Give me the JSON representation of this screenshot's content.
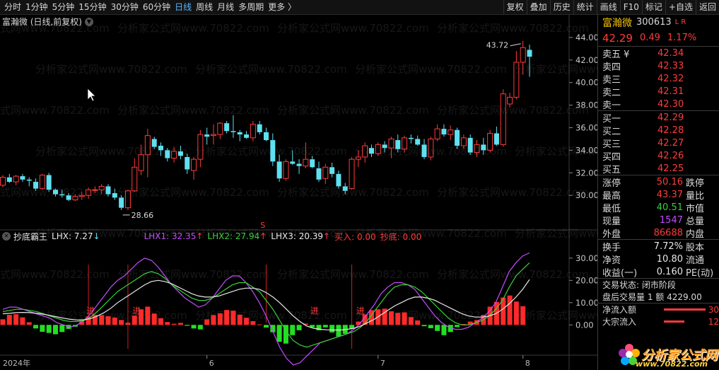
{
  "toolbar": {
    "periods": [
      "分时",
      "1分钟",
      "5分钟",
      "15分钟",
      "30分钟",
      "60分钟",
      "日线",
      "周线",
      "月线",
      "多周期",
      "更多 〉"
    ],
    "active_period": "日线",
    "buttons": [
      "复权",
      "叠加",
      "历史",
      "统计",
      "画线",
      "F10",
      "标记",
      "+自选",
      "返回"
    ]
  },
  "chart": {
    "title": "富瀚微 (日线,前复权)",
    "title_icon": "chevron-down-icon",
    "price_axis": [
      "44.00",
      "42.00",
      "40.00",
      "38.00",
      "36.00",
      "34.00",
      "32.00",
      "30.00"
    ],
    "high_label": "43.72",
    "low_label": "28.66",
    "marker_s": "S",
    "indicator": {
      "name": "抄底霸王",
      "lhx": "LHX: 7.27",
      "lhx1": "LHX1: 32.35",
      "lhx2": "LHX2: 27.94",
      "lhx3": "LHX3: 20.39",
      "buy": "买入: 0.00",
      "bottom": "抄底: 0.00",
      "axis": [
        "30.00",
        "20.00",
        "10.00",
        "0.00"
      ],
      "jin_label": "进"
    },
    "date_axis": [
      "2024年",
      "6",
      "7",
      "8"
    ],
    "watermark": "分析家公式网www.70822.com"
  },
  "quote": {
    "name": "富瀚微",
    "code": "300613",
    "lr": "L R",
    "price": "42.29",
    "change": "0.49",
    "pct": "1.17%",
    "asks": [
      {
        "label": "卖五 ¥",
        "price": "42.34"
      },
      {
        "label": "卖四",
        "price": "42.33"
      },
      {
        "label": "卖三",
        "price": "42.32"
      },
      {
        "label": "卖二",
        "price": "42.31"
      },
      {
        "label": "卖一",
        "price": "42.30"
      }
    ],
    "bids": [
      {
        "label": "买一",
        "price": "42.29"
      },
      {
        "label": "买二",
        "price": "42.28"
      },
      {
        "label": "买三",
        "price": "42.27"
      },
      {
        "label": "买四",
        "price": "42.26"
      },
      {
        "label": "买五",
        "price": "42.25"
      }
    ],
    "stats1": [
      {
        "label": "涨停",
        "value": "50.16",
        "vcolor": "#ff3b3b",
        "right": "跌停"
      },
      {
        "label": "最高",
        "value": "43.37",
        "vcolor": "#ff3b3b",
        "right": "量比"
      },
      {
        "label": "最低",
        "value": "40.51",
        "vcolor": "#39d039",
        "right": "市值"
      },
      {
        "label": "现量",
        "value": "1547",
        "vcolor": "#c44dff",
        "right": "总量"
      },
      {
        "label": "外盘",
        "value": "86688",
        "vcolor": "#ff3b3b",
        "right": "内盘"
      }
    ],
    "stats2": [
      {
        "label": "换手",
        "value": "7.72%",
        "vcolor": "#e8e8e8",
        "right": "股本"
      },
      {
        "label": "净资",
        "value": "10.80",
        "vcolor": "#e8e8e8",
        "right": "流通"
      },
      {
        "label": "收益(一)",
        "value": "0.160",
        "vcolor": "#e8e8e8",
        "right": "PE(动)"
      }
    ],
    "trade_state": "交易状态: 闭市阶段",
    "after_hours": "盘后交易量 1 额 4229.00",
    "net_inflow_label": "净流入额",
    "net_inflow_value": "30",
    "big_order_label": "大宗流入",
    "big_order_value": "12"
  },
  "logo": {
    "text": "分析家公式网",
    "url": "www.70822.com"
  },
  "colors": {
    "up": "#ff3b3b",
    "down": "#5ee0f0",
    "lhx1": "#c44dff",
    "lhx2": "#39d039",
    "lhx3": "#e8e8e8"
  },
  "candles": [
    [
      30.9,
      31.8,
      30.7,
      31.6
    ],
    [
      31.6,
      31.9,
      31.1,
      31.2
    ],
    [
      31.2,
      31.8,
      30.9,
      31.7
    ],
    [
      31.7,
      31.9,
      31.2,
      31.4
    ],
    [
      31.4,
      31.6,
      30.8,
      31.3
    ],
    [
      31.2,
      31.5,
      30.4,
      30.6
    ],
    [
      30.6,
      31.9,
      30.5,
      31.8
    ],
    [
      31.8,
      32.0,
      30.3,
      30.5
    ],
    [
      30.5,
      30.6,
      29.9,
      30.1
    ],
    [
      30.1,
      30.5,
      29.8,
      30.0
    ],
    [
      30.0,
      30.2,
      29.5,
      29.6
    ],
    [
      29.6,
      30.1,
      29.5,
      29.9
    ],
    [
      29.9,
      30.3,
      29.6,
      30.0
    ],
    [
      30.0,
      30.7,
      29.7,
      30.5
    ],
    [
      30.5,
      30.8,
      30.2,
      30.5
    ],
    [
      30.5,
      31.0,
      30.1,
      30.8
    ],
    [
      30.8,
      31.0,
      29.9,
      30.1
    ],
    [
      30.2,
      30.6,
      29.6,
      29.8
    ],
    [
      29.8,
      30.0,
      28.7,
      28.9
    ],
    [
      28.9,
      30.5,
      28.7,
      30.4
    ],
    [
      30.4,
      33.3,
      30.3,
      32.5
    ],
    [
      32.2,
      34.5,
      31.8,
      33.6
    ],
    [
      33.6,
      35.9,
      31.6,
      35.3
    ],
    [
      35.0,
      35.2,
      34.1,
      34.3
    ],
    [
      34.4,
      34.7,
      33.5,
      34.0
    ],
    [
      34.0,
      34.2,
      33.0,
      33.3
    ],
    [
      33.3,
      34.3,
      32.9,
      33.9
    ],
    [
      33.9,
      34.4,
      33.2,
      33.5
    ],
    [
      33.4,
      33.7,
      31.9,
      32.3
    ],
    [
      32.2,
      33.4,
      31.4,
      33.2
    ],
    [
      33.2,
      35.8,
      32.5,
      35.4
    ],
    [
      35.4,
      36.0,
      34.5,
      35.2
    ],
    [
      35.3,
      36.3,
      34.5,
      35.4
    ],
    [
      35.4,
      36.5,
      35.0,
      36.4
    ],
    [
      36.4,
      36.6,
      35.5,
      35.7
    ],
    [
      35.7,
      37.1,
      35.1,
      35.6
    ],
    [
      35.6,
      35.8,
      34.8,
      35.4
    ],
    [
      35.4,
      35.7,
      35.0,
      35.1
    ],
    [
      35.1,
      36.6,
      34.8,
      36.3
    ],
    [
      36.3,
      36.6,
      35.4,
      35.6
    ],
    [
      35.6,
      36.0,
      34.8,
      34.9
    ],
    [
      34.9,
      35.5,
      32.6,
      33.0
    ],
    [
      33.0,
      33.6,
      31.2,
      31.5
    ],
    [
      31.5,
      33.2,
      31.3,
      33.0
    ],
    [
      33.0,
      34.0,
      32.7,
      32.8
    ],
    [
      32.8,
      33.2,
      31.9,
      32.6
    ],
    [
      32.6,
      34.7,
      32.4,
      33.2
    ],
    [
      33.2,
      33.5,
      32.4,
      32.5
    ],
    [
      32.4,
      33.0,
      31.2,
      31.4
    ],
    [
      31.5,
      32.8,
      31.0,
      32.5
    ],
    [
      32.5,
      32.9,
      31.6,
      31.9
    ],
    [
      31.9,
      32.2,
      30.6,
      30.8
    ],
    [
      30.8,
      31.1,
      30.1,
      30.4
    ],
    [
      30.6,
      33.4,
      30.5,
      33.2
    ],
    [
      33.2,
      34.0,
      32.5,
      33.4
    ],
    [
      33.4,
      34.7,
      32.9,
      34.4
    ],
    [
      34.2,
      34.5,
      33.4,
      33.7
    ],
    [
      33.7,
      34.7,
      33.5,
      34.5
    ],
    [
      34.5,
      34.8,
      33.8,
      34.2
    ],
    [
      34.2,
      35.2,
      33.3,
      35.0
    ],
    [
      34.9,
      35.4,
      33.8,
      34.1
    ],
    [
      34.1,
      35.3,
      33.8,
      35.1
    ],
    [
      35.1,
      35.4,
      34.6,
      35.0
    ],
    [
      35.0,
      35.3,
      34.4,
      34.5
    ],
    [
      34.5,
      35.0,
      33.2,
      33.4
    ],
    [
      33.4,
      35.2,
      33.1,
      35.0
    ],
    [
      35.0,
      36.3,
      34.8,
      35.9
    ],
    [
      35.9,
      36.3,
      35.2,
      35.4
    ],
    [
      35.4,
      36.2,
      34.9,
      35.8
    ],
    [
      35.8,
      36.0,
      34.1,
      34.4
    ],
    [
      34.4,
      35.4,
      34.1,
      35.1
    ],
    [
      35.1,
      35.4,
      33.6,
      33.8
    ],
    [
      33.8,
      34.9,
      33.4,
      34.5
    ],
    [
      34.5,
      35.1,
      33.6,
      34.0
    ],
    [
      34.0,
      35.8,
      33.8,
      35.5
    ],
    [
      35.5,
      36.1,
      34.4,
      34.5
    ],
    [
      34.5,
      39.4,
      34.3,
      39.0
    ],
    [
      38.1,
      39.1,
      37.8,
      38.7
    ],
    [
      38.7,
      42.8,
      38.5,
      41.8
    ],
    [
      41.8,
      43.7,
      40.7,
      43.1
    ],
    [
      42.9,
      43.37,
      40.51,
      42.29
    ]
  ],
  "ind_bars": [
    2.5,
    4.5,
    4.8,
    3.4,
    1.2,
    -1.6,
    -3.1,
    -3.6,
    -4.2,
    -3.2,
    -1.8,
    -0.8,
    1.6,
    3.8,
    4.5,
    4.4,
    3.9,
    3.3,
    2.2,
    1.0,
    4.2,
    7.0,
    8.2,
    5.1,
    3.0,
    1.3,
    0.5,
    0.9,
    -0.4,
    -1.6,
    -2.0,
    2.5,
    4.4,
    5.2,
    6.7,
    6.4,
    4.6,
    3.2,
    1.7,
    0.2,
    -1.2,
    -3.3,
    -7.6,
    -8.4,
    -4.6,
    -2.4,
    0.6,
    -1.1,
    -2.4,
    -1.1,
    -3.4,
    -5.2,
    -4.0,
    -1.6,
    1.5,
    4.7,
    6.6,
    7.0,
    7.3,
    6.1,
    5.4,
    5.6,
    3.5,
    2.0,
    -0.6,
    -1.5,
    -2.7,
    -4.6,
    -3.2,
    -1.0,
    0.4,
    1.5,
    2.2,
    4.5,
    8.2,
    10.3,
    12.3,
    13.2,
    10.5,
    8.4
  ],
  "lhx1_pts": [
    7,
    8,
    8,
    7,
    6,
    5,
    4,
    3,
    1,
    0,
    -1,
    0,
    2,
    5,
    9,
    13,
    17,
    20,
    22,
    25,
    28,
    30,
    29,
    26,
    22,
    18,
    15,
    12,
    10,
    8,
    9,
    12,
    16,
    20,
    22,
    22,
    19,
    15,
    10,
    4,
    -3,
    -10,
    -15,
    -18,
    -17,
    -14,
    -11,
    -8,
    -7,
    -6,
    -5,
    -4,
    -2,
    1,
    5,
    9,
    14,
    17,
    19,
    19,
    18,
    16,
    12,
    8,
    4,
    1,
    -1,
    -2,
    -2,
    -1,
    1,
    3,
    6,
    10,
    17,
    24,
    28,
    31,
    32.35
  ],
  "lhx2_pts": [
    6,
    6.5,
    7,
    7,
    6.5,
    6,
    5,
    4,
    3,
    2,
    1.5,
    1.5,
    2,
    3.5,
    6,
    9,
    12,
    15,
    17,
    19,
    21,
    23,
    24,
    23,
    21,
    18,
    16,
    14,
    12,
    11,
    11,
    12,
    14,
    16,
    18,
    19,
    19,
    17,
    15,
    11,
    7,
    2,
    -3,
    -7,
    -9,
    -10,
    -9,
    -8,
    -7,
    -6,
    -5,
    -4,
    -3,
    -1,
    2,
    6,
    10,
    14,
    17,
    18,
    18,
    17,
    15,
    12,
    9,
    6,
    3,
    1,
    0,
    0,
    1,
    2,
    4,
    7,
    11,
    17,
    22,
    25,
    27.94
  ],
  "lhx3_pts": [
    5,
    5.2,
    5.5,
    5.6,
    5.5,
    5.2,
    4.8,
    4.2,
    3.6,
    3,
    2.5,
    2.2,
    2.3,
    2.8,
    4,
    5.5,
    7.5,
    10,
    12,
    14,
    16,
    18,
    19.5,
    20,
    19.5,
    18.5,
    17,
    15.5,
    14,
    13,
    12.5,
    12.5,
    13,
    14,
    15,
    16,
    16.5,
    16.5,
    16,
    14.5,
    12.5,
    10,
    7,
    4,
    1.5,
    -0.5,
    -1.5,
    -2,
    -2.2,
    -2.3,
    -2.3,
    -2,
    -1.5,
    -0.5,
    1,
    2.5,
    4.5,
    6.5,
    8.5,
    10,
    11.5,
    12.5,
    12.5,
    12,
    11,
    9.5,
    8,
    6.5,
    5,
    4,
    3.5,
    3.5,
    4,
    5,
    7,
    9.5,
    12.5,
    16,
    20.39
  ]
}
